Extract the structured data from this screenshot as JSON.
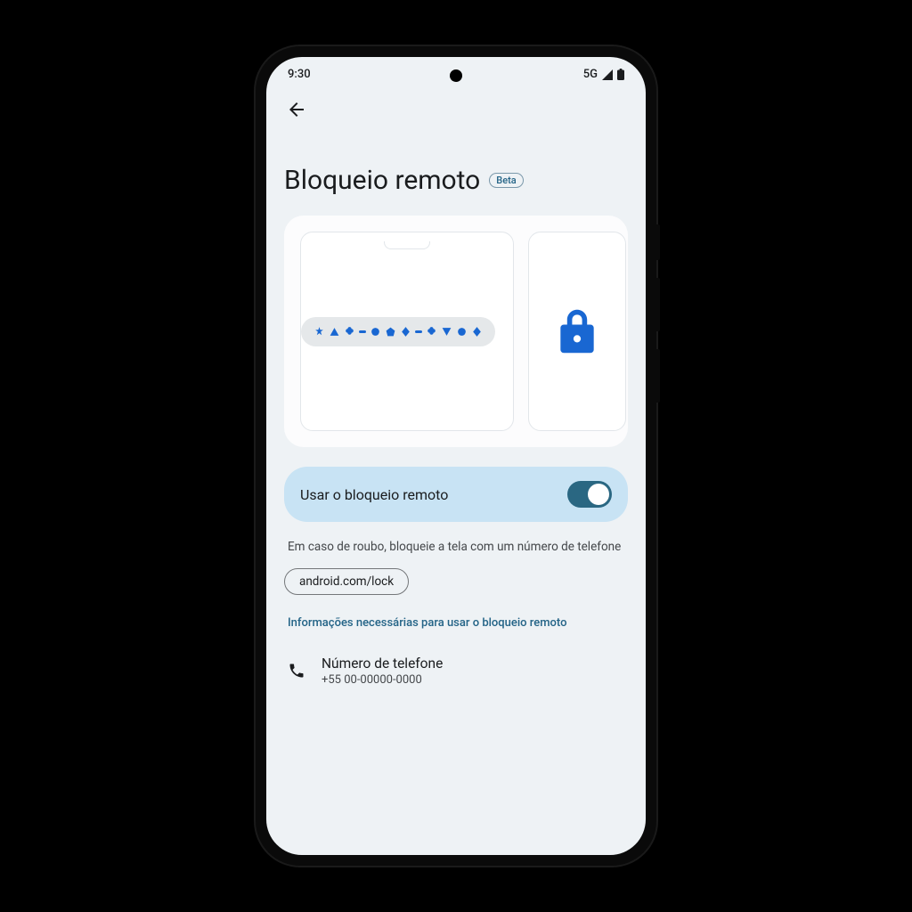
{
  "statusBar": {
    "time": "9:30",
    "network": "5G"
  },
  "header": {
    "title": "Bloqueio remoto",
    "badge": "Beta"
  },
  "toggle": {
    "label": "Usar o bloqueio remoto",
    "enabled": true
  },
  "description": "Em caso de roubo, bloqueie a tela com um número de telefone",
  "linkChip": "android.com/lock",
  "infoLink": "Informações necessárias para usar o bloqueio remoto",
  "phoneSection": {
    "title": "Número de telefone",
    "value": "+55 00-00000-0000"
  },
  "colors": {
    "accent": "#1967d2",
    "toggleTrack": "#2a6782",
    "toggleRow": "#c8e3f4",
    "link": "#246487"
  }
}
